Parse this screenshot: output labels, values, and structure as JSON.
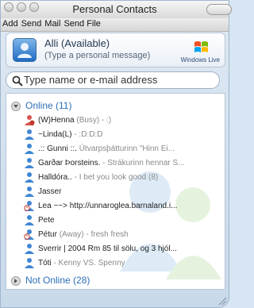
{
  "window": {
    "title": "Personal Contacts"
  },
  "menu": {
    "items": [
      "Add",
      "Send",
      "Mail",
      "Send File"
    ]
  },
  "user": {
    "name": "Alli (Available)",
    "message_placeholder": "(Type a personal message)",
    "brand_label": "Windows Live"
  },
  "search": {
    "placeholder": "Type name or e-mail address"
  },
  "groups": {
    "online": {
      "label": "Online (11)"
    },
    "not_online": {
      "label": "Not Online (28)"
    }
  },
  "contacts": [
    {
      "name": "(W)Henna",
      "status": "(Busy) - :)",
      "icon": "busy-user-icon"
    },
    {
      "name": "~Linda(L)",
      "status": " - :D:D:D",
      "icon": "user-icon"
    },
    {
      "name": ".:: Gunni ::.",
      "status": " Útvarpsþátturinn \"Hinn Ei...",
      "icon": "user-icon"
    },
    {
      "name": "Garðar Þorsteins.",
      "status": " - Strákurinn hennar S...",
      "icon": "user-icon"
    },
    {
      "name": "Halldóra..",
      "status": " - I bet you look good (8)",
      "icon": "user-icon"
    },
    {
      "name": "Jasser",
      "status": "",
      "icon": "user-icon"
    },
    {
      "name": "Lea ~~> http://unnaroglea.barnaland.i...",
      "status": "",
      "icon": "away-user-icon"
    },
    {
      "name": "Pete",
      "status": "",
      "icon": "user-icon"
    },
    {
      "name": "Pétur",
      "status": "(Away) - fresh fresh",
      "icon": "away-user-icon"
    },
    {
      "name": "Sverrir | 2004 Rm 85 til sölu, og 3 hjól...",
      "status": "",
      "icon": "user-icon"
    },
    {
      "name": "Tóti",
      "status": " - Kenny VS. Spenny",
      "icon": "user-icon"
    }
  ],
  "colors": {
    "accent": "#2c6fb7",
    "list_bg": "#ffffff",
    "frame_bg": "#d7e6f2"
  }
}
